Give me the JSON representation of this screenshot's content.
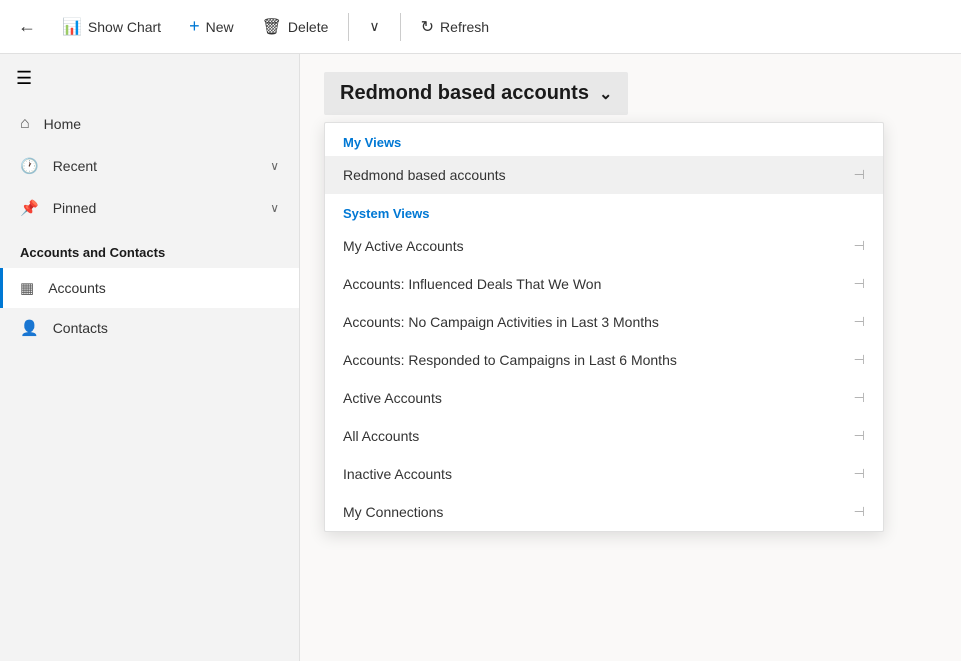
{
  "toolbar": {
    "back_label": "←",
    "show_chart_label": "Show Chart",
    "new_label": "New",
    "delete_label": "Delete",
    "refresh_label": "Refresh",
    "show_chart_icon": "📊",
    "new_icon": "+",
    "delete_icon": "🗑",
    "refresh_icon": "↻"
  },
  "sidebar": {
    "hamburger_icon": "☰",
    "nav_items": [
      {
        "id": "home",
        "icon": "⌂",
        "label": "Home",
        "has_chevron": false
      },
      {
        "id": "recent",
        "icon": "🕐",
        "label": "Recent",
        "has_chevron": true
      },
      {
        "id": "pinned",
        "icon": "📌",
        "label": "Pinned",
        "has_chevron": true
      }
    ],
    "section_title": "Accounts and Contacts",
    "account_items": [
      {
        "id": "accounts",
        "icon": "▦",
        "label": "Accounts",
        "active": true
      },
      {
        "id": "contacts",
        "icon": "👤",
        "label": "Contacts",
        "active": false
      }
    ]
  },
  "view_selector": {
    "current_view": "Redmond based accounts",
    "chevron": "⌄"
  },
  "dropdown": {
    "my_views_section": "My Views",
    "system_views_section": "System Views",
    "selected_item": "Redmond based accounts",
    "my_views_items": [
      {
        "id": "redmond",
        "label": "Redmond based accounts"
      }
    ],
    "system_views_items": [
      {
        "id": "my-active",
        "label": "My Active Accounts"
      },
      {
        "id": "influenced-deals",
        "label": "Accounts: Influenced Deals That We Won"
      },
      {
        "id": "no-campaign",
        "label": "Accounts: No Campaign Activities in Last 3 Months"
      },
      {
        "id": "responded-campaigns",
        "label": "Accounts: Responded to Campaigns in Last 6 Months"
      },
      {
        "id": "active-accounts",
        "label": "Active Accounts"
      },
      {
        "id": "all-accounts",
        "label": "All Accounts"
      },
      {
        "id": "inactive-accounts",
        "label": "Inactive Accounts"
      },
      {
        "id": "my-connections",
        "label": "My Connections"
      }
    ],
    "pin_icon": "⊣"
  }
}
